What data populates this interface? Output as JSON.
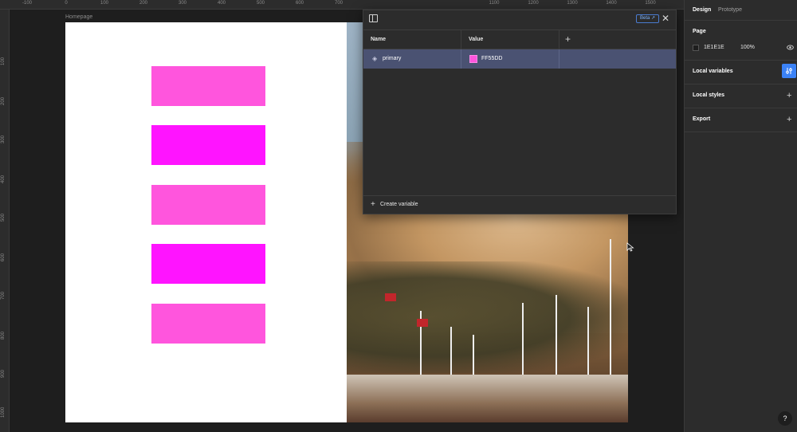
{
  "ruler": {
    "top_ticks": [
      "-100",
      "0",
      "100",
      "200",
      "300",
      "400",
      "500",
      "600",
      "700",
      "1100",
      "1200",
      "1300",
      "1400",
      "1500"
    ],
    "left_ticks": [
      "100",
      "200",
      "300",
      "400",
      "500",
      "600",
      "700",
      "800",
      "900",
      "1000"
    ]
  },
  "canvas": {
    "frame_label": "Homepage",
    "rect_colors": [
      "#ff55dd",
      "#ff14ff",
      "#ff55dd",
      "#ff14ff",
      "#ff55dd"
    ]
  },
  "variables_panel": {
    "beta_label": "Beta",
    "columns": {
      "name": "Name",
      "value": "Value"
    },
    "rows": [
      {
        "name": "primary",
        "value": "FF55DD",
        "swatch_color": "#ff55dd",
        "icon": "color-variable-icon"
      }
    ],
    "create_label": "Create variable"
  },
  "right_panel": {
    "tabs": [
      "Design",
      "Prototype"
    ],
    "page": {
      "title": "Page",
      "hex": "1E1E1E",
      "opacity": "100%"
    },
    "local_variables": "Local variables",
    "local_styles": "Local styles",
    "export": "Export",
    "help": "?"
  }
}
